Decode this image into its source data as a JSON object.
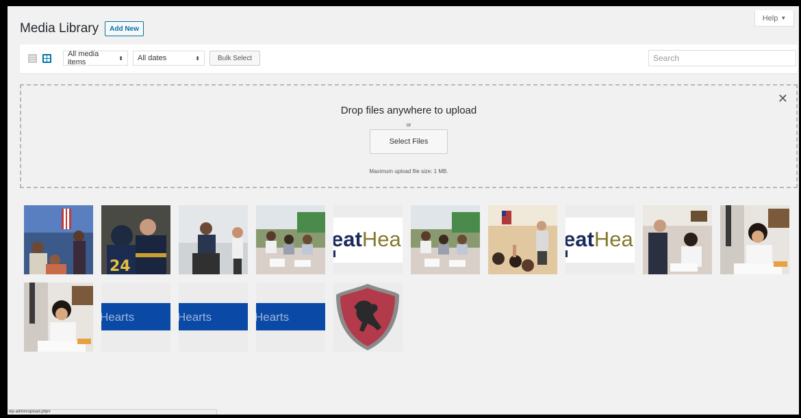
{
  "help": {
    "label": "Help",
    "caret": "▼"
  },
  "header": {
    "title": "Media Library",
    "add_new": "Add New"
  },
  "toolbar": {
    "view_modes": [
      {
        "name": "list-view-icon",
        "active": false
      },
      {
        "name": "grid-view-icon",
        "active": true
      }
    ],
    "filter_type": {
      "value": "All media items",
      "arrows": "⬍"
    },
    "filter_date": {
      "value": "All dates",
      "arrows": "⬍"
    },
    "bulk_select": "Bulk Select",
    "search_placeholder": "Search"
  },
  "dropzone": {
    "title": "Drop files anywhere to upload",
    "or": "or",
    "button": "Select Files",
    "max_size": "Maximum upload file size: 1 MB."
  },
  "colors": {
    "accent": "#0073aa",
    "banner_blue": "#0a49a6",
    "logo_navy": "#1b2a5c",
    "logo_olive": "#827a2e",
    "shield_red": "#b23a4a"
  },
  "media": [
    {
      "kind": "photo",
      "subject": "classroom-flag"
    },
    {
      "kind": "photo",
      "subject": "football"
    },
    {
      "kind": "photo",
      "subject": "teacher-student"
    },
    {
      "kind": "photo",
      "subject": "students-desk"
    },
    {
      "kind": "logo",
      "text": "eatHea"
    },
    {
      "kind": "photo",
      "subject": "students-desk"
    },
    {
      "kind": "photo",
      "subject": "classroom-teacher"
    },
    {
      "kind": "logo",
      "text": "eatHea"
    },
    {
      "kind": "photo",
      "subject": "students-writing"
    },
    {
      "kind": "photo",
      "subject": "girl-writing"
    },
    {
      "kind": "photo",
      "subject": "girl-writing"
    },
    {
      "kind": "banner",
      "text": "Hearts"
    },
    {
      "kind": "banner",
      "text": "Hearts"
    },
    {
      "kind": "banner",
      "text": "Hearts"
    },
    {
      "kind": "shield",
      "subject": "horse-crest"
    }
  ],
  "status_bar": "wp-admin/upload.php#"
}
